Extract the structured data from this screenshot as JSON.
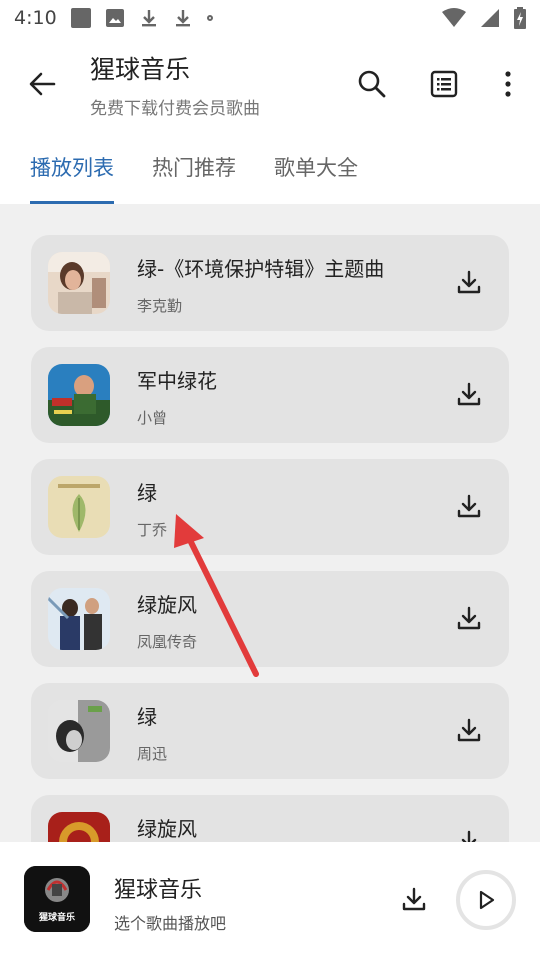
{
  "status_bar": {
    "time": "4:10",
    "icons": [
      "notification-square-icon",
      "image-icon",
      "download-icon",
      "download-icon",
      "dot-icon",
      "wifi-icon",
      "signal-icon",
      "battery-charging-icon"
    ]
  },
  "app_bar": {
    "title": "猩球音乐",
    "subtitle": "免费下载付费会员歌曲",
    "icons": [
      "back-arrow-icon",
      "search-icon",
      "list-icon",
      "more-vertical-icon"
    ]
  },
  "tabs": [
    {
      "label": "播放列表",
      "active": true
    },
    {
      "label": "热门推荐",
      "active": false
    },
    {
      "label": "歌单大全",
      "active": false
    }
  ],
  "songs": [
    {
      "title": "绿-《环境保护特辑》主题曲",
      "artist": "李克勤"
    },
    {
      "title": "军中绿花",
      "artist": "小曾"
    },
    {
      "title": "绿",
      "artist": "丁乔"
    },
    {
      "title": "绿旋风",
      "artist": "凤凰传奇"
    },
    {
      "title": "绿",
      "artist": "周迅"
    },
    {
      "title": "绿旋风",
      "artist": ""
    }
  ],
  "player": {
    "cover_label": "猩球音乐",
    "title": "猩球音乐",
    "subtitle": "选个歌曲播放吧"
  },
  "colors": {
    "accent": "#2c6bb0",
    "card_bg": "#e3e3e3",
    "list_bg": "#f0f0f0",
    "annotation_arrow": "#e23b3b"
  }
}
